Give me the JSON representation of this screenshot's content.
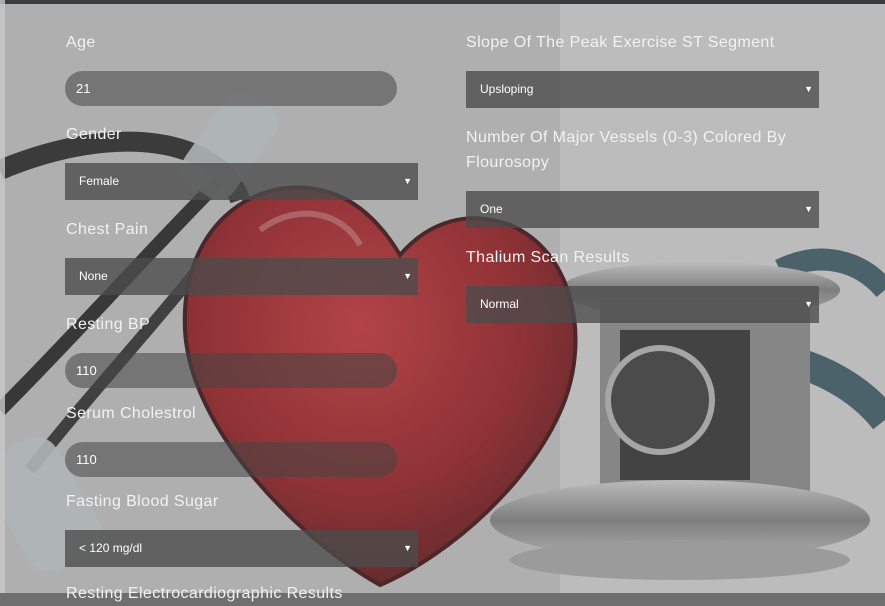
{
  "form": {
    "age": {
      "label": "Age",
      "value": "21"
    },
    "gender": {
      "label": "Gender",
      "value": "Female"
    },
    "chest_pain": {
      "label": "Chest Pain",
      "value": "None"
    },
    "resting_bp": {
      "label": "Resting BP",
      "value": "110"
    },
    "serum_cholesterol": {
      "label": "Serum Cholestrol",
      "value": "110"
    },
    "fasting_blood_sugar": {
      "label": "Fasting Blood Sugar",
      "value": "< 120 mg/dl"
    },
    "resting_ecg": {
      "label": "Resting Electrocardiographic Results"
    },
    "slope": {
      "label": "Slope Of The Peak Exercise ST Segment",
      "value": "Upsloping"
    },
    "major_vessels": {
      "label_line1": "Number Of Major Vessels (0-3) Colored By",
      "label_line2": "Flourosopy",
      "value": "One"
    },
    "thalium": {
      "label": "Thalium Scan Results",
      "value": "Normal"
    }
  },
  "icons": {
    "caret": "▼"
  },
  "colors": {
    "heart": "#b01217",
    "overlay": "#6f6f6f"
  }
}
